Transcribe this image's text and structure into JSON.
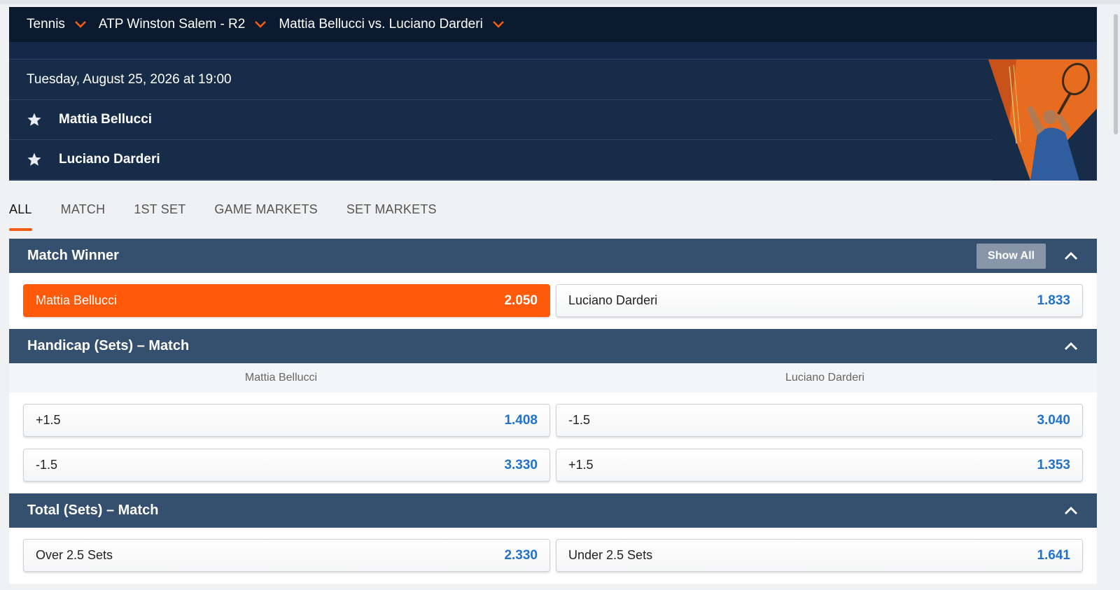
{
  "breadcrumb": {
    "sport": "Tennis",
    "tournament": "ATP Winston Salem - R2",
    "match": "Mattia Bellucci vs. Luciano Darderi"
  },
  "event": {
    "datetime": "Tuesday, August 25, 2026 at 19:00",
    "players": [
      "Mattia Bellucci",
      "Luciano Darderi"
    ]
  },
  "tabs": [
    "ALL",
    "MATCH",
    "1ST SET",
    "GAME MARKETS",
    "SET MARKETS"
  ],
  "active_tab": "ALL",
  "markets": {
    "match_winner": {
      "title": "Match Winner",
      "show_all": "Show All",
      "options": [
        {
          "label": "Mattia Bellucci",
          "price": "2.050",
          "selected": true
        },
        {
          "label": "Luciano Darderi",
          "price": "1.833",
          "selected": false
        }
      ]
    },
    "handicap": {
      "title": "Handicap (Sets) – Match",
      "columns": [
        "Mattia Bellucci",
        "Luciano Darderi"
      ],
      "rows": [
        [
          {
            "label": "+1.5",
            "price": "1.408"
          },
          {
            "label": "-1.5",
            "price": "3.040"
          }
        ],
        [
          {
            "label": "-1.5",
            "price": "3.330"
          },
          {
            "label": "+1.5",
            "price": "1.353"
          }
        ]
      ]
    },
    "total": {
      "title": "Total (Sets) – Match",
      "options": [
        {
          "label": "Over 2.5 Sets",
          "price": "2.330"
        },
        {
          "label": "Under 2.5 Sets",
          "price": "1.641"
        }
      ]
    }
  },
  "colors": {
    "accent": "#ff5a0a",
    "price": "#2472c8",
    "header_dark": "#0b1a2e",
    "market_header": "#34506e"
  }
}
